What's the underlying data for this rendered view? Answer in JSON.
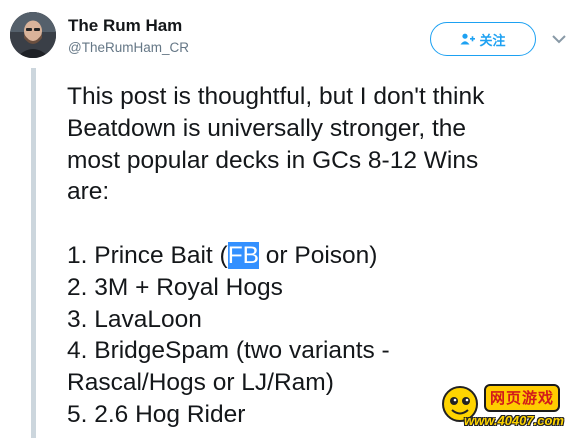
{
  "tweet": {
    "author": {
      "name": "The Rum Ham",
      "handle": "@TheRumHam_CR"
    },
    "follow_label": "关注",
    "lines": [
      "This post is thoughtful, but I don't think",
      "Beatdown is universally stronger, the",
      "most popular decks in GCs 8-12 Wins",
      "are:"
    ],
    "list": {
      "item1_before": "1. Prince Bait (",
      "item1_selected": "FB",
      "item1_after": " or Poison)",
      "item2": "2. 3M + Royal Hogs",
      "item3": "3. LavaLoon",
      "item4_line1": "4. BridgeSpam (two variants -",
      "item4_line2": "Rascal/Hogs or LJ/Ram)",
      "item5": "5. 2.6 Hog Rider"
    }
  },
  "watermark": {
    "title": "网页游戏",
    "url": "www.40407.com"
  },
  "colors": {
    "accent": "#1da1f2",
    "selection": "#3390ff",
    "thread_line": "#ccd6dd"
  },
  "icons": [
    "avatar-photo",
    "add-user-icon",
    "chevron-down-icon",
    "watermark-mascot-icon"
  ]
}
